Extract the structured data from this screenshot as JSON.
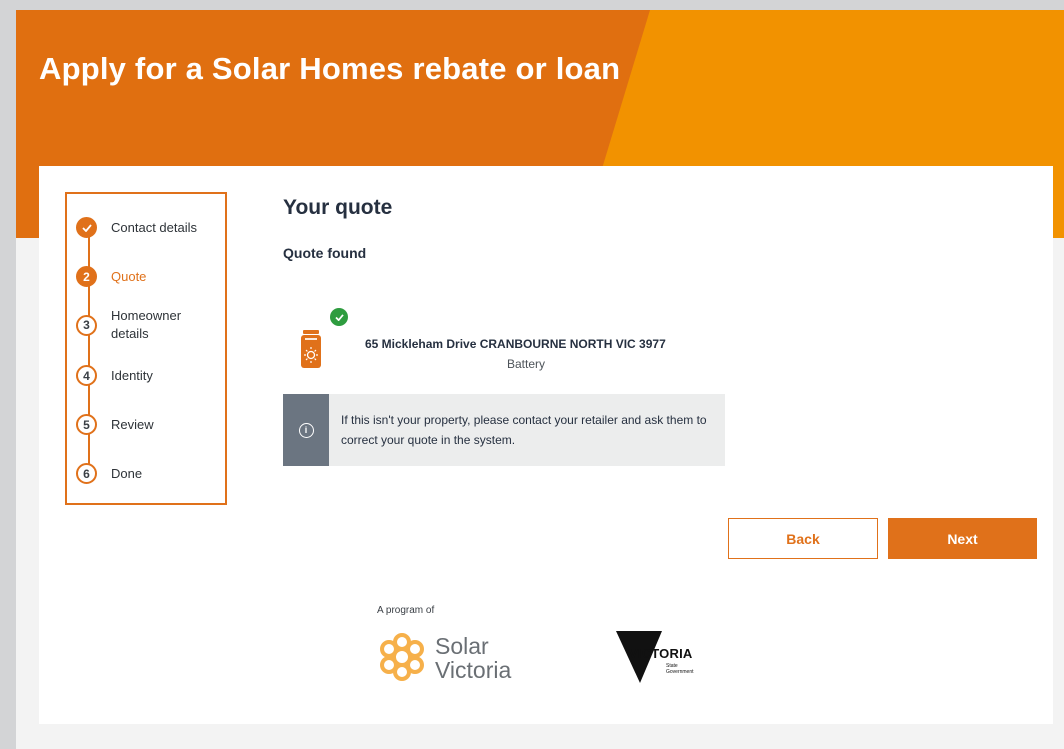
{
  "page": {
    "title": "Apply for a Solar Homes rebate or loan"
  },
  "steps": [
    {
      "number": "",
      "label": "Contact details",
      "status": "completed"
    },
    {
      "number": "2",
      "label": "Quote",
      "status": "current"
    },
    {
      "number": "3",
      "label": "Homeowner details",
      "status": "upcoming"
    },
    {
      "number": "4",
      "label": "Identity",
      "status": "upcoming"
    },
    {
      "number": "5",
      "label": "Review",
      "status": "upcoming"
    },
    {
      "number": "6",
      "label": "Done",
      "status": "upcoming"
    }
  ],
  "quote": {
    "heading": "Your quote",
    "status": "Quote found",
    "address": "65 Mickleham Drive CRANBOURNE NORTH VIC 3977",
    "product": "Battery",
    "info_message": "If this isn't your property, please contact your retailer and ask them to correct your quote in the system."
  },
  "actions": {
    "back_label": "Back",
    "next_label": "Next"
  },
  "footer": {
    "program_of": "A program of",
    "solar_victoria_line1": "Solar",
    "solar_victoria_line2": "Victoria",
    "victoria_text": "VICTORIA",
    "victoria_sub_line1": "State",
    "victoria_sub_line2": "Government"
  },
  "colors": {
    "brand_orange": "#e0711a",
    "hero_light": "#f29200",
    "success_green": "#2e9c3f",
    "info_grey": "#6b7581",
    "text_dark": "#263040"
  },
  "icons": {
    "completed_step": "check-icon",
    "product": "battery-icon",
    "quote_found": "check-circle-icon",
    "info": "info-icon"
  }
}
